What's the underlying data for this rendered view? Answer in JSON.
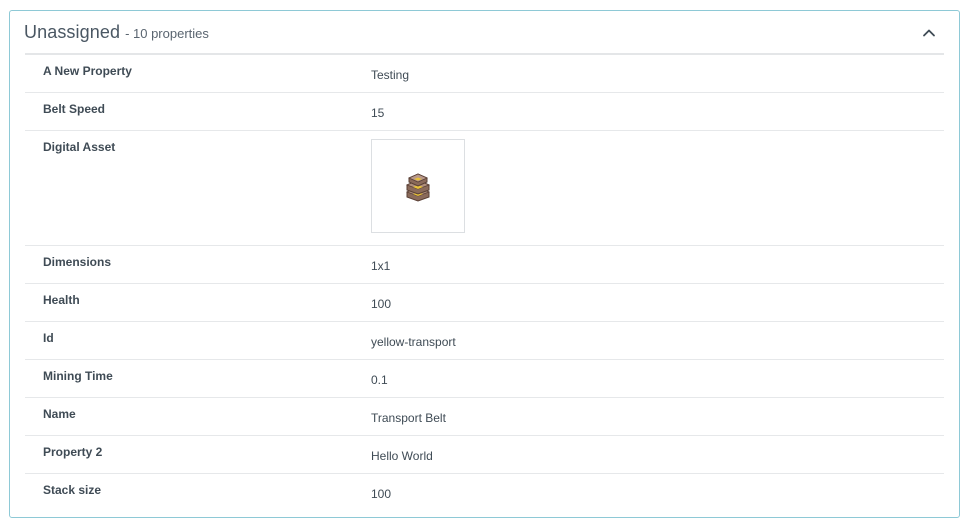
{
  "section": {
    "title": "Unassigned",
    "count_label": "- 10 properties"
  },
  "properties": [
    {
      "name": "A New Property",
      "value": "Testing"
    },
    {
      "name": "Belt Speed",
      "value": "15"
    },
    {
      "name": "Digital Asset",
      "value": null,
      "asset_icon": "transport-belt-icon"
    },
    {
      "name": "Dimensions",
      "value": "1x1"
    },
    {
      "name": "Health",
      "value": "100"
    },
    {
      "name": "Id",
      "value": "yellow-transport"
    },
    {
      "name": "Mining Time",
      "value": "0.1"
    },
    {
      "name": "Name",
      "value": "Transport Belt"
    },
    {
      "name": "Property 2",
      "value": "Hello World"
    },
    {
      "name": "Stack size",
      "value": "100"
    }
  ],
  "colors": {
    "panel_border": "#8ec9d6",
    "text": "#3f4b55",
    "divider": "#e6e8ea"
  }
}
